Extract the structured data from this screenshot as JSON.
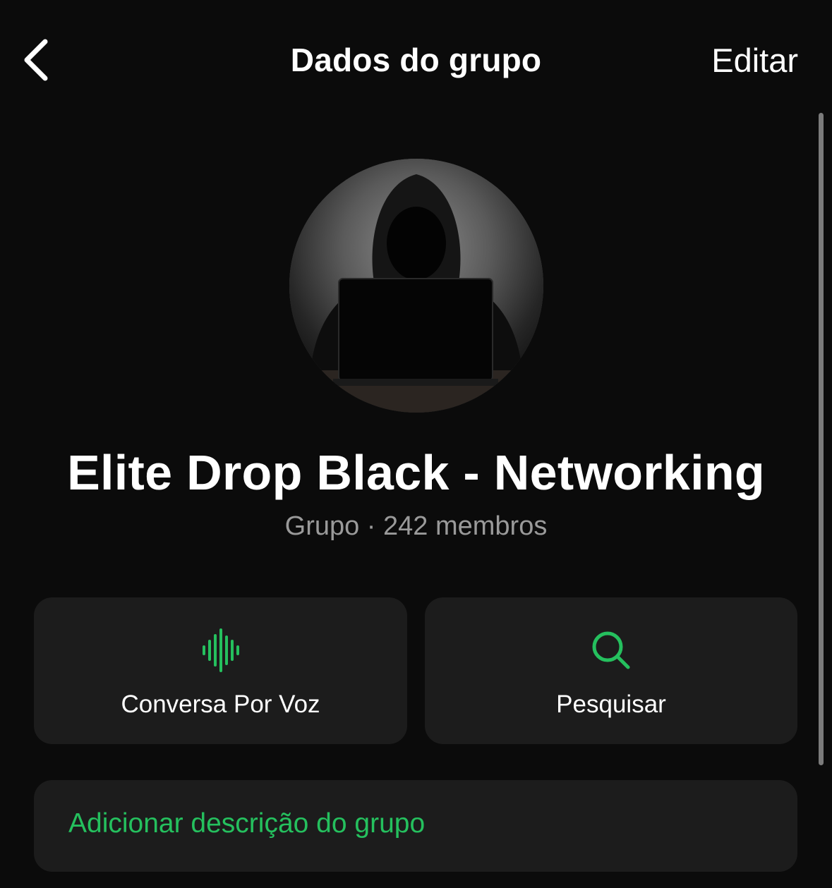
{
  "nav": {
    "title": "Dados do grupo",
    "edit_label": "Editar",
    "back_icon": "chevron-left-icon"
  },
  "group": {
    "name": "Elite Drop Black - Networking",
    "meta": "Grupo · 242 membros",
    "avatar_description_icon": "group-avatar"
  },
  "actions": [
    {
      "label": "Conversa Por Voz",
      "icon": "voice-waveform-icon"
    },
    {
      "label": "Pesquisar",
      "icon": "search-icon"
    }
  ],
  "description": {
    "add_label": "Adicionar descrição do grupo"
  },
  "colors": {
    "background": "#0b0b0b",
    "card": "#1c1c1c",
    "accent": "#25c05e",
    "secondary_text": "#9a9a9a"
  }
}
